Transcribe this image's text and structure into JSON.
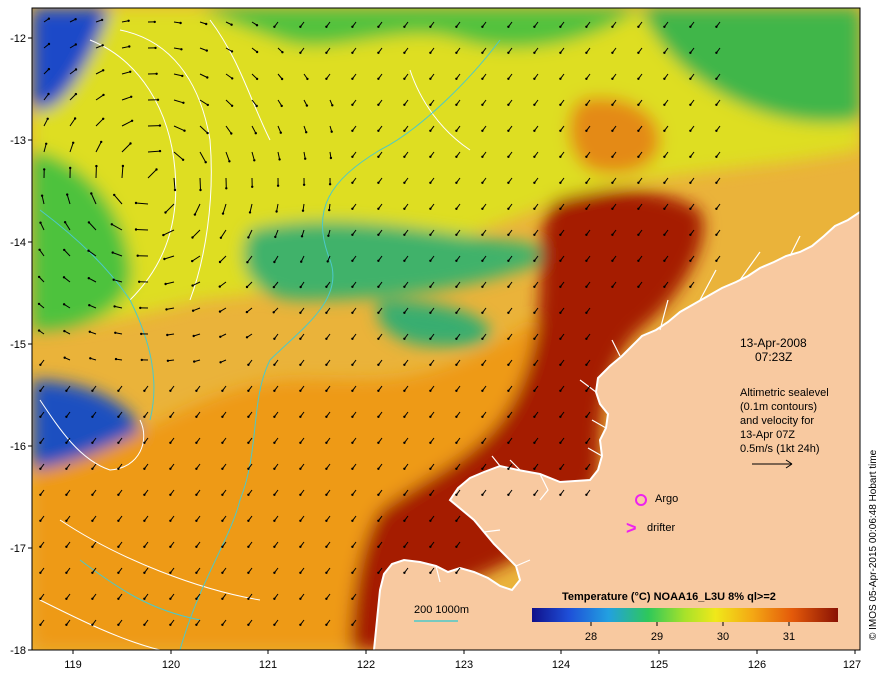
{
  "map": {
    "x_ticks": [
      "119",
      "120",
      "121",
      "122",
      "123",
      "124",
      "125",
      "126",
      "127"
    ],
    "y_ticks": [
      "-12",
      "-13",
      "-14",
      "-15",
      "-16",
      "-17",
      "-18"
    ],
    "date_line1": "13-Apr-2008",
    "date_line2": "07:23Z",
    "info_lines": [
      "Altimetric sealevel",
      "(0.1m contours)",
      "and velocity for",
      "13-Apr 07Z",
      "0.5m/s (1kt 24h)"
    ],
    "argo_label": "Argo",
    "drifter_label": "drifter",
    "drifter_glyph": ">",
    "bathymetry_label": "200  1000m",
    "colorbar_title": "Temperature (°C) NOAA16_L3U 8% ql>=2",
    "colorbar_ticks": [
      "28",
      "29",
      "30",
      "31"
    ],
    "credit": "© IMOS 05-Apr-2015 00:06:48 Hobart time"
  },
  "colors": {
    "land": "#f8c9a0",
    "warm": "#9a1c05",
    "orange": "#e9900e",
    "yellow": "#e6e21a",
    "green": "#4fc33b",
    "blue": "#1536b8",
    "magenta": "#ee22ee",
    "cyan": "#4cc9c9"
  }
}
